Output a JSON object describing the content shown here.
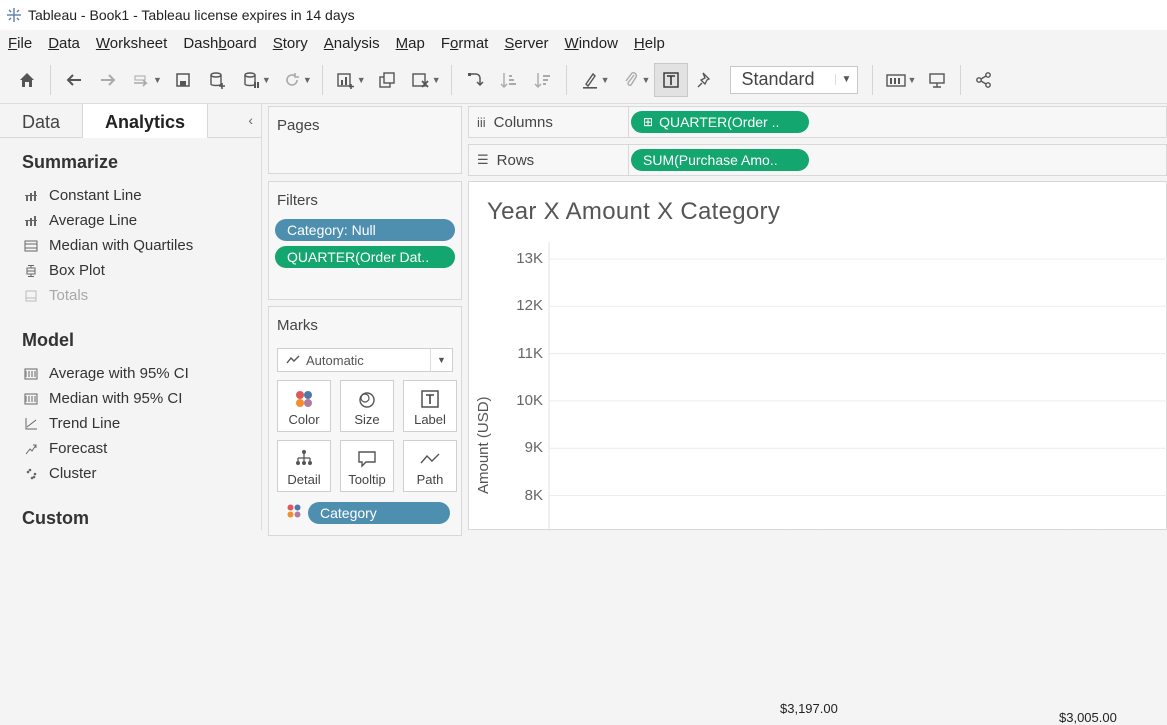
{
  "window": {
    "title": "Tableau - Book1 - Tableau license expires in 14 days"
  },
  "menu": [
    {
      "pre": "",
      "u": "F",
      "post": "ile"
    },
    {
      "pre": "",
      "u": "D",
      "post": "ata"
    },
    {
      "pre": "",
      "u": "W",
      "post": "orksheet"
    },
    {
      "pre": "Dash",
      "u": "b",
      "post": "oard"
    },
    {
      "pre": "",
      "u": "S",
      "post": "tory"
    },
    {
      "pre": "",
      "u": "A",
      "post": "nalysis"
    },
    {
      "pre": "",
      "u": "M",
      "post": "ap"
    },
    {
      "pre": "F",
      "u": "o",
      "post": "rmat"
    },
    {
      "pre": "",
      "u": "S",
      "post": "erver"
    },
    {
      "pre": "",
      "u": "W",
      "post": "indow"
    },
    {
      "pre": "",
      "u": "H",
      "post": "elp"
    }
  ],
  "toolbar": {
    "fit_value": "Standard"
  },
  "left_pane": {
    "tabs": {
      "data": "Data",
      "analytics": "Analytics"
    },
    "summarize": {
      "title": "Summarize",
      "items": [
        "Constant Line",
        "Average Line",
        "Median with Quartiles",
        "Box Plot",
        "Totals"
      ]
    },
    "model": {
      "title": "Model",
      "items": [
        "Average with 95% CI",
        "Median with 95% CI",
        "Trend Line",
        "Forecast",
        "Cluster"
      ]
    },
    "custom": {
      "title": "Custom"
    }
  },
  "pages": {
    "title": "Pages"
  },
  "filters": {
    "title": "Filters",
    "pills": [
      "Category: Null",
      "QUARTER(Order Dat.."
    ]
  },
  "marks": {
    "title": "Marks",
    "type": "Automatic",
    "buttons": [
      "Color",
      "Size",
      "Label",
      "Detail",
      "Tooltip",
      "Path"
    ],
    "field_pill": "Category"
  },
  "shelves": {
    "columns_label": "Columns",
    "columns_pill": "QUARTER(Order ..",
    "rows_label": "Rows",
    "rows_pill": "SUM(Purchase Amo.."
  },
  "colors": {
    "line": "#e15759",
    "green_pill": "#14a66f",
    "blue_pill": "#4e8fb0"
  },
  "chart_data": {
    "type": "line",
    "title": "Year X Amount  X  Category",
    "ylabel": "Amount (USD)",
    "yticks": [
      "13K",
      "12K",
      "11K",
      "10K",
      "9K",
      "8K"
    ],
    "ylim": [
      8000,
      13000
    ],
    "grid": true,
    "points": [
      {
        "value": 3197,
        "label": "$3,197.00"
      },
      {
        "value": 3005,
        "label": "$3,005.00"
      }
    ]
  }
}
